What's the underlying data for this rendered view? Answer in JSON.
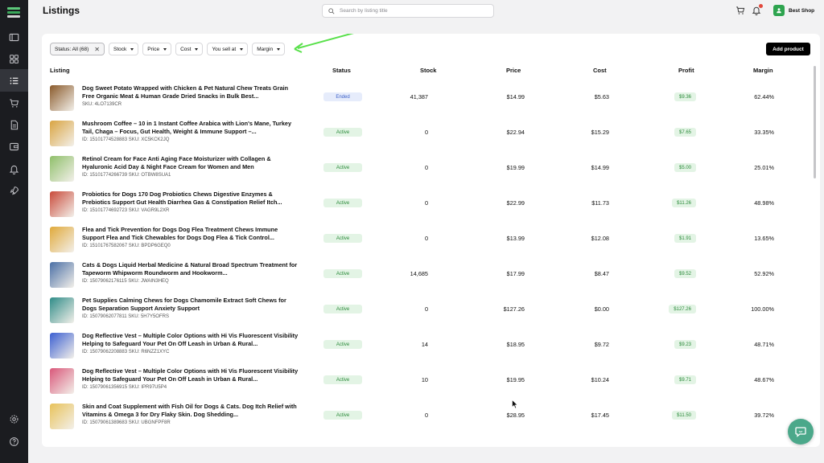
{
  "app": {
    "page_title": "Listings",
    "shop_name": "Best Shop",
    "colors": {
      "sidebar": "#1b1c20",
      "accent": "#2ea44f",
      "arrow": "#58e04a"
    }
  },
  "search": {
    "placeholder": "Search by listing title",
    "value": ""
  },
  "sidebar": {
    "items": [
      {
        "icon": "dashboard-icon"
      },
      {
        "icon": "grid-icon"
      },
      {
        "icon": "listings-icon",
        "active": true
      },
      {
        "icon": "cart-icon"
      },
      {
        "icon": "document-icon"
      },
      {
        "icon": "wallet-icon"
      },
      {
        "icon": "bell-icon"
      },
      {
        "icon": "rocket-icon"
      }
    ],
    "bottom": [
      {
        "icon": "settings-icon"
      },
      {
        "icon": "help-icon"
      }
    ]
  },
  "filters": {
    "status": "Status: All (68)",
    "stock": "Stock",
    "price": "Price",
    "cost": "Cost",
    "you_sell_at": "You sell at",
    "margin": "Margin"
  },
  "add_product": "Add product",
  "table": {
    "headers": {
      "listing": "Listing",
      "status": "Status",
      "stock": "Stock",
      "price": "Price",
      "cost": "Cost",
      "profit": "Profit",
      "margin": "Margin"
    },
    "rows": [
      {
        "title": "Dog Sweet Potato Wrapped with Chicken & Pet Natural Chew Treats Grain Free Organic Meat & Human Grade Dried Snacks in Bulk Best...",
        "meta": "SKU: 4LO7139CR",
        "status": "Ended",
        "stock": "41,387",
        "price": "$14.99",
        "cost": "$5.63",
        "profit": "$9.36",
        "margin": "62.44%"
      },
      {
        "title": "Mushroom Coffee – 10 in 1 Instant Coffee Arabica with Lion's Mane, Turkey Tail, Chaga – Focus, Gut Health, Weight & Immune Support –...",
        "meta": "ID: 15101774528883   SKU: XC5KCK2JQ",
        "status": "Active",
        "stock": "0",
        "price": "$22.94",
        "cost": "$15.29",
        "profit": "$7.65",
        "margin": "33.35%"
      },
      {
        "title": "Retinol Cream for Face Anti Aging Face Moisturizer with Collagen & Hyaluronic Acid Day & Night Face Cream for Women and Men",
        "meta": "ID: 15101774266739   SKU: OTBW8SUA1",
        "status": "Active",
        "stock": "0",
        "price": "$19.99",
        "cost": "$14.99",
        "profit": "$5.00",
        "margin": "25.01%"
      },
      {
        "title": "Probiotics for Dogs 170 Dog Probiotics Chews Digestive Enzymes & Prebiotics Support Gut Health Diarrhea Gas & Constipation Relief Itch...",
        "meta": "ID: 15101774692723   SKU: VAGR9L2XR",
        "status": "Active",
        "stock": "0",
        "price": "$22.99",
        "cost": "$11.73",
        "profit": "$11.26",
        "margin": "48.98%"
      },
      {
        "title": "Flea and Tick Prevention for Dogs Dog Flea Treatment Chews Immune Support Flea and Tick Chewables for Dogs Dog Flea & Tick Control...",
        "meta": "ID: 15101767582067   SKU: BPDP6GEQ0",
        "status": "Active",
        "stock": "0",
        "price": "$13.99",
        "cost": "$12.08",
        "profit": "$1.91",
        "margin": "13.65%"
      },
      {
        "title": "Cats & Dogs Liquid Herbal Medicine & Natural Broad Spectrum Treatment for Tapeworm Whipworm Roundworm and Hookworm...",
        "meta": "ID: 15079062176115   SKU: JWAIN3HEQ",
        "status": "Active",
        "stock": "14,685",
        "price": "$17.99",
        "cost": "$8.47",
        "profit": "$9.52",
        "margin": "52.92%"
      },
      {
        "title": "Pet Supplies Calming Chews for Dogs Chamomile Extract Soft Chews for Dogs Separation Support Anxiety Support",
        "meta": "ID: 15079062077811   SKU: 5H7Y5OFRS",
        "status": "Active",
        "stock": "0",
        "price": "$127.26",
        "cost": "$0.00",
        "profit": "$127.26",
        "margin": "100.00%"
      },
      {
        "title": "Dog Reflective Vest – Multiple Color Options with Hi Vis Fluorescent Visibility Helping to Safeguard Your Pet On Off Leash in Urban & Rural...",
        "meta": "ID: 15079062208883   SKU: R6NZZ1XYC",
        "status": "Active",
        "stock": "14",
        "price": "$18.95",
        "cost": "$9.72",
        "profit": "$9.23",
        "margin": "48.71%"
      },
      {
        "title": "Dog Reflective Vest – Multiple Color Options with Hi Vis Fluorescent Visibility Helping to Safeguard Your Pet On Off Leash in Urban & Rural...",
        "meta": "ID: 15079061356915   SKU: IPR97U5P4",
        "status": "Active",
        "stock": "10",
        "price": "$19.95",
        "cost": "$10.24",
        "profit": "$9.71",
        "margin": "48.67%"
      },
      {
        "title": "Skin and Coat Supplement with Fish Oil for Dogs & Cats. Dog Itch Relief with Vitamins & Omega 3 for Dry Flaky Skin. Dog Shedding...",
        "meta": "ID: 15079061389683   SKU: UBGNFPF8R",
        "status": "Active",
        "stock": "0",
        "price": "$28.95",
        "cost": "$17.45",
        "profit": "$11.50",
        "margin": "39.72%"
      }
    ]
  }
}
